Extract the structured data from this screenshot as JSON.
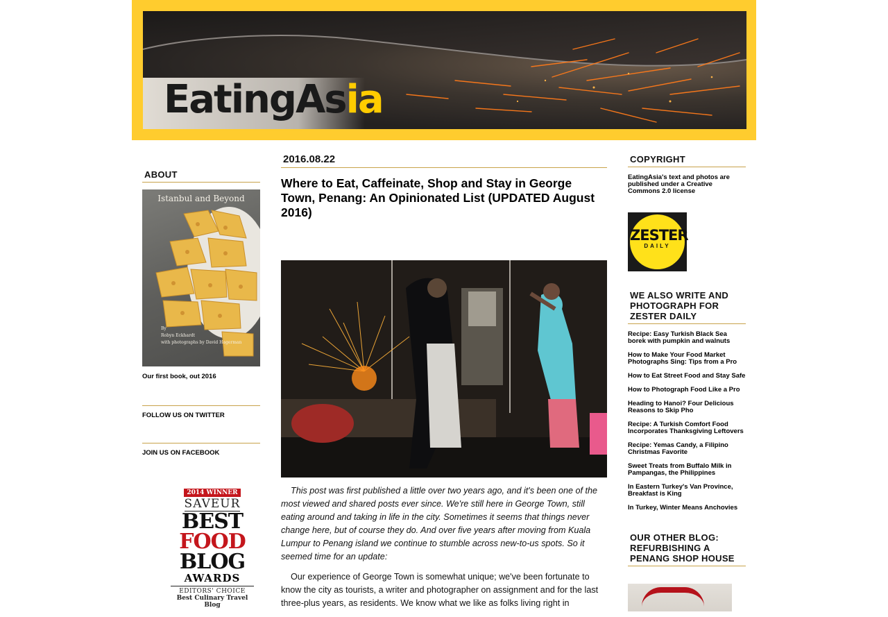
{
  "site": {
    "logo_main": "EatingAs",
    "logo_highlight": "ia"
  },
  "left_sidebar": {
    "about_heading": "ABOUT",
    "book": {
      "title": "Istanbul and Beyond",
      "credit_line1": "By",
      "credit_line2": "Robyn Eckhardt",
      "credit_line3": "with photographs by David Hagerman",
      "caption": "Our first book, out 2016"
    },
    "twitter_link": "FOLLOW US ON TWITTER",
    "facebook_link": "JOIN US ON FACEBOOK",
    "award": {
      "winner": "2014 WINNER",
      "brand": "SAVEUR",
      "line1": "BEST",
      "line2": "FOOD",
      "line3": "BLOG",
      "line4": "AWARDS",
      "editors": "EDITORS' CHOICE",
      "category": "Best Culinary Travel Blog"
    }
  },
  "post": {
    "date": "2016.08.22",
    "title": "Where to Eat, Caffeinate, Shop and Stay in George Town, Penang: An Opinionated List (UPDATED August 2016)",
    "intro": "This post was first published a little over two years ago, and it's been one of the most viewed and shared posts ever since. We're still here in George Town, still eating around and taking in life in the city. Sometimes it seems that things never change here, but of course they do. And over five years after moving from Kuala Lumpur to Penang island we continue to stumble across new-to-us spots. So it seemed time for an update:",
    "paragraph2": "Our experience of George Town is somewhat unique; we've been fortunate to know the city as tourists, a writer and photographer on assignment and for the last three-plus years, as residents. We know what we like as folks living right in"
  },
  "right_sidebar": {
    "copyright_heading": "COPYRIGHT",
    "copyright_text": "EatingAsia's text and photos are published under a Creative Commons 2.0 license",
    "zester_logo_word": "ZESTER",
    "zester_logo_sub": "DAILY",
    "write_heading": "WE ALSO WRITE AND PHOTOGRAPH FOR ZESTER DAILY",
    "links": [
      "Recipe: Easy Turkish Black Sea borek with pumpkin and walnuts",
      "How to Make Your Food Market Photographs Sing: Tips from a Pro",
      "How to Eat Street Food and Stay Safe",
      "How to Photograph Food Like a Pro",
      "Heading to Hanoi? Four Delicious Reasons to Skip Pho",
      "Recipe: A Turkish Comfort Food Incorporates Thanksgiving Leftovers",
      "Recipe: Yemas Candy, a Filipino Christmas Favorite",
      "Sweet Treats from Buffalo Milk in Pampangas, the Philippines",
      "In Eastern Turkey's Van Province, Breakfast is King",
      "In Turkey, Winter Means Anchovies"
    ],
    "other_blog_heading": "OUR OTHER BLOG: REFURBISHING A PENANG SHOP HOUSE"
  },
  "colors": {
    "header_yellow": "#ffcc2e",
    "rule_gold": "#c8a24a",
    "award_red": "#c4161c",
    "zester_yellow": "#ffe11a"
  }
}
